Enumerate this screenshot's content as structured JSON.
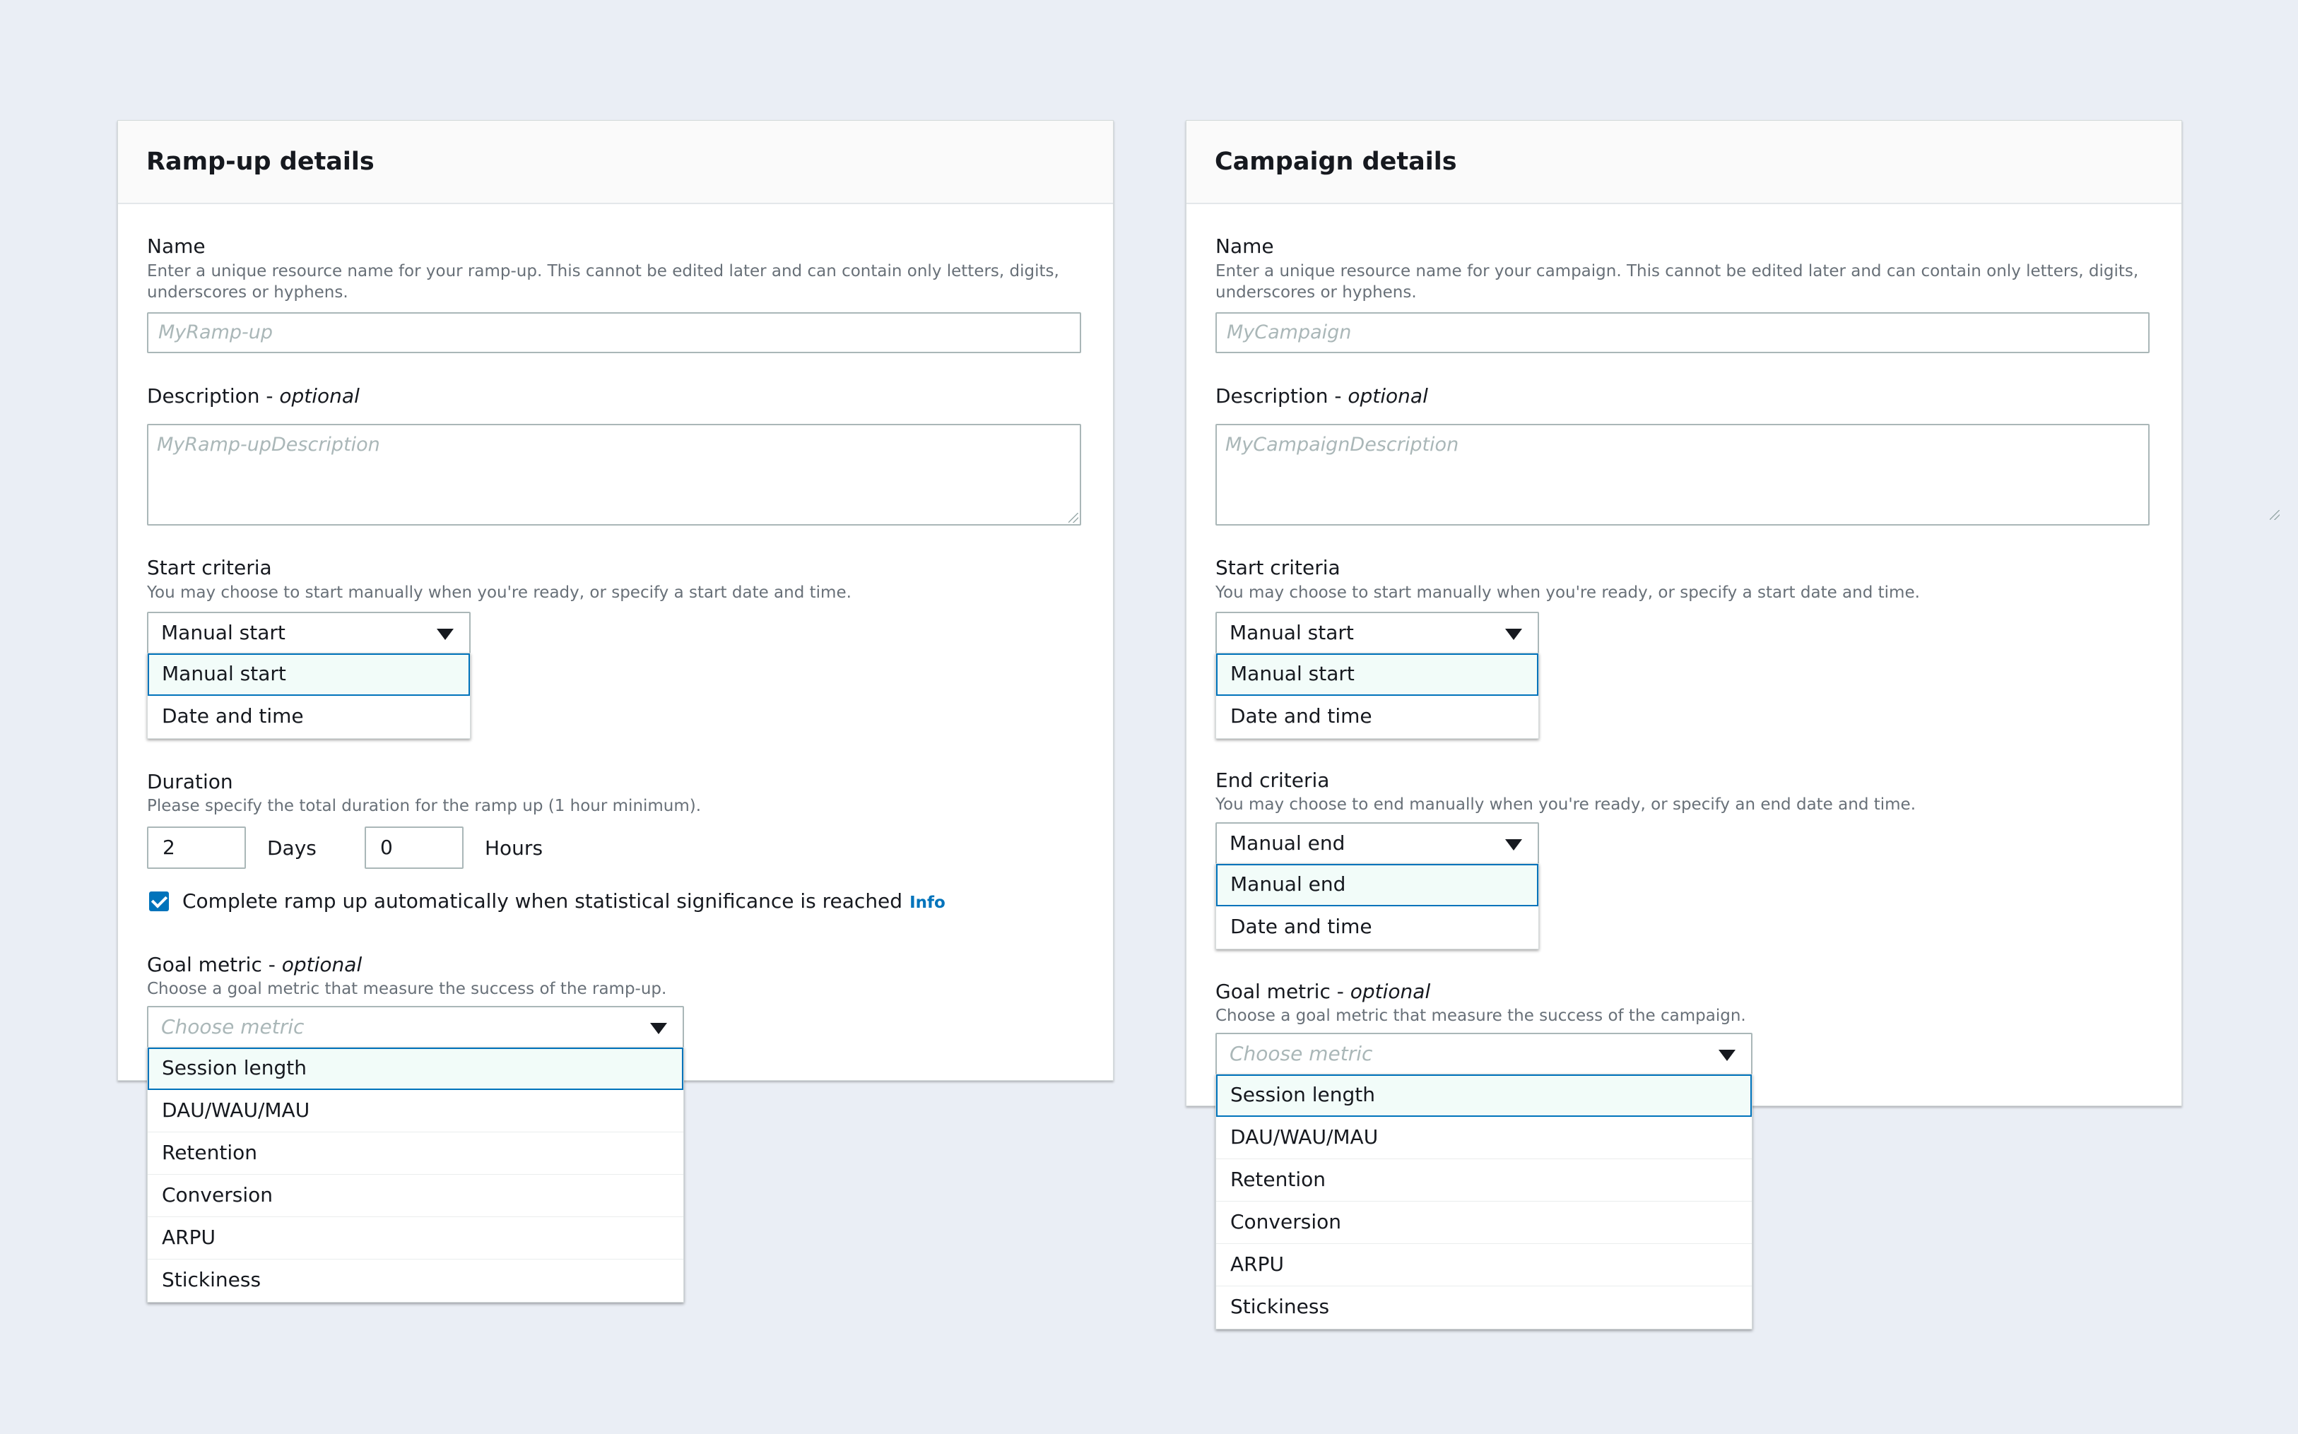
{
  "rampup": {
    "title": "Ramp-up details",
    "name_label": "Name",
    "name_desc_line1": "Enter a unique resource name for your ramp-up. This cannot be edited later and can contain only letters, digits,",
    "name_desc_line2": "underscores or hyphens.",
    "name_placeholder": "MyRamp-up",
    "description_label": "Description",
    "optional_text": "optional",
    "description_placeholder": "MyRamp-upDescription",
    "start_label": "Start criteria",
    "start_desc": "You may choose to start manually when you're ready, or specify a start date and time.",
    "start_value": "Manual start",
    "start_options": [
      "Manual start",
      "Date and time"
    ],
    "duration_label": "Duration",
    "duration_desc": "Please specify the total duration for the ramp up (1 hour minimum).",
    "days_value": "2",
    "days_unit": "Days",
    "hours_value": "0",
    "hours_unit": "Hours",
    "auto_complete_label": "Complete ramp up automatically when statistical significance is reached",
    "auto_complete_checked": true,
    "info_link": "Info",
    "goal_label": "Goal metric",
    "goal_desc": "Choose a goal metric that measure the success of the ramp-up.",
    "goal_placeholder": "Choose metric",
    "goal_options": [
      "Session length",
      "DAU/WAU/MAU",
      "Retention",
      "Conversion",
      "ARPU",
      "Stickiness"
    ]
  },
  "campaign": {
    "title": "Campaign details",
    "name_label": "Name",
    "name_desc_line1": "Enter a unique resource name for your campaign. This cannot be edited later and can contain only letters, digits,",
    "name_desc_line2": "underscores or hyphens.",
    "name_placeholder": "MyCampaign",
    "description_label": "Description",
    "optional_text": "optional",
    "description_placeholder": "MyCampaignDescription",
    "start_label": "Start criteria",
    "start_desc": "You may choose to start manually when you're ready, or specify a start date and time.",
    "start_value": "Manual start",
    "start_options": [
      "Manual start",
      "Date and time"
    ],
    "end_label": "End criteria",
    "end_desc": "You may choose to end manually when you're ready, or specify an end date and time.",
    "end_value": "Manual end",
    "end_options": [
      "Manual end",
      "Date and time"
    ],
    "goal_label": "Goal metric",
    "goal_desc": "Choose a goal metric that measure the success of the campaign.",
    "goal_placeholder": "Choose metric",
    "goal_options": [
      "Session length",
      "DAU/WAU/MAU",
      "Retention",
      "Conversion",
      "ARPU",
      "Stickiness"
    ]
  },
  "colors": {
    "background": "#eaeef5",
    "accent": "#0073bb",
    "placeholder": "#aab7b8",
    "description_text": "#687078"
  }
}
